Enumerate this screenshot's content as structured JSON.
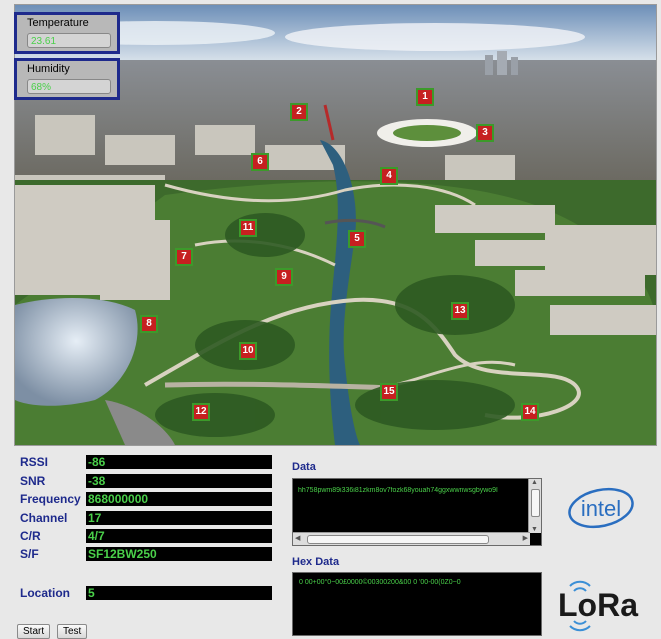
{
  "sensors": {
    "temperature": {
      "label": "Temperature",
      "value": "23.61"
    },
    "humidity": {
      "label": "Humidity",
      "value": "68%"
    }
  },
  "markers": [
    "1",
    "2",
    "3",
    "4",
    "5",
    "6",
    "7",
    "8",
    "9",
    "10",
    "11",
    "12",
    "13",
    "14",
    "15"
  ],
  "fields": {
    "rssi": {
      "label": "RSSI",
      "value": "-86"
    },
    "snr": {
      "label": "SNR",
      "value": "-38"
    },
    "frequency": {
      "label": "Frequency",
      "value": "868000000"
    },
    "channel": {
      "label": "Channel",
      "value": "17"
    },
    "cr": {
      "label": "C/R",
      "value": "4/7"
    },
    "sf": {
      "label": "S/F",
      "value": "SF12BW250"
    },
    "location": {
      "label": "Location",
      "value": "5"
    }
  },
  "buttons": {
    "start": "Start",
    "test": "Test"
  },
  "data_panel": {
    "title": "Data",
    "text": "hh758pwm89i336i81zkm8ov7fozk68youah74ggxwwnwsgbywo9l"
  },
  "hex_panel": {
    "title": "Hex Data",
    "text": "0  00+00°0~00£0000©00300200&00 0  '00-00(0Z0~0"
  },
  "logos": {
    "intel": "intel",
    "lora": "LoRa"
  },
  "colors": {
    "accent": "#1e2a8c",
    "value_green": "#4ad04a",
    "marker_red": "#c62020"
  }
}
